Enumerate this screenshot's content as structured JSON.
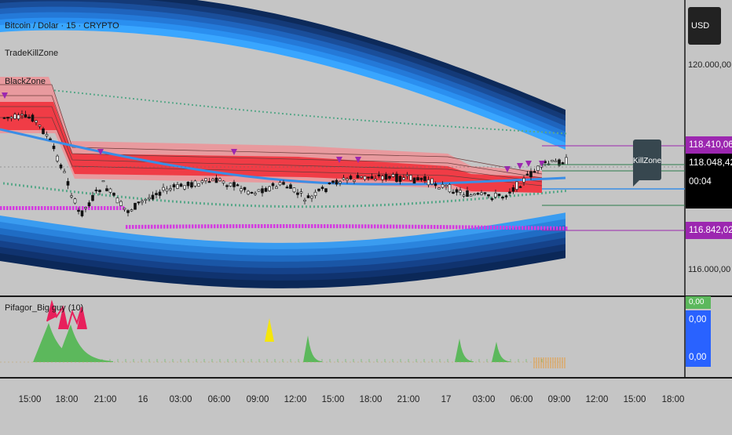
{
  "header": {
    "symbol_title": "Bitcoin / Dolar · 15 · CRYPTO",
    "indicators": [
      "TradeKillZone",
      "BlackZone"
    ]
  },
  "price_axis": {
    "currency": "USD",
    "labels": [
      "120.000,00",
      "116.000,00"
    ],
    "tags": {
      "upper_level": "118.410,06",
      "last_price": "118.048,42",
      "countdown": "00:04",
      "lower_level": "116.842,02"
    }
  },
  "callout": {
    "label": "KillZone"
  },
  "lower_pane": {
    "title": "Pifagor_Big guy (10)",
    "values": [
      "0,00",
      "0,00",
      "0,00"
    ]
  },
  "time_axis": {
    "labels": [
      "15:00",
      "18:00",
      "21:00",
      "16",
      "03:00",
      "06:00",
      "09:00",
      "12:00",
      "15:00",
      "18:00",
      "21:00",
      "17",
      "03:00",
      "06:00",
      "09:00",
      "12:00",
      "15:00",
      "18:00"
    ]
  },
  "colors": {
    "background": "#c5c5c5",
    "upper_band": "#1e90ff",
    "lower_band": "#0d2a5a",
    "killzone_fill": "#f03c46",
    "killzone_band": "#e89a9e",
    "magenta_line": "#d43be0",
    "teal_dots": "#5aa88a",
    "ma_line": "#3a8ee6",
    "histogram_green": "#5cb85c",
    "histogram_red": "#e8205c",
    "alert_yellow": "#f5e60a",
    "purple_tag": "#9c27b0",
    "blue_tag": "#2962ff"
  }
}
